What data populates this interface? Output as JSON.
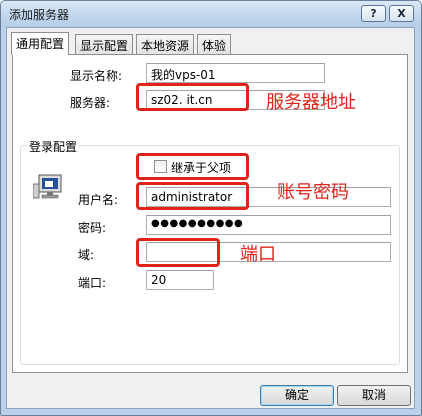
{
  "window": {
    "title": "添加服务器",
    "help_glyph": "?",
    "close_glyph": "X"
  },
  "tabs": [
    {
      "label": "通用配置",
      "active": true
    },
    {
      "label": "显示配置",
      "active": false
    },
    {
      "label": "本地资源",
      "active": false
    },
    {
      "label": "体验",
      "active": false
    }
  ],
  "form": {
    "display_name_label": "显示名称:",
    "display_name_value": "我的vps-01",
    "server_label": "服务器:",
    "server_value": "sz02.        it.cn",
    "login_group_title": "登录配置",
    "inherit_label": "继承于父项",
    "username_label": "用户名:",
    "username_value": "administrator",
    "password_label": "密码:",
    "password_value": "●●●●●●●●●●",
    "domain_label": "域:",
    "domain_value": "",
    "port_label": "端口:",
    "port_value": "20"
  },
  "annotations": {
    "server_note": "服务器地址",
    "account_note": "账号密码",
    "port_note": "端口",
    "color": "#e2231a"
  },
  "buttons": {
    "ok": "确定",
    "cancel": "取消"
  },
  "icons": {
    "login_icon": "computer-monitor-icon"
  }
}
